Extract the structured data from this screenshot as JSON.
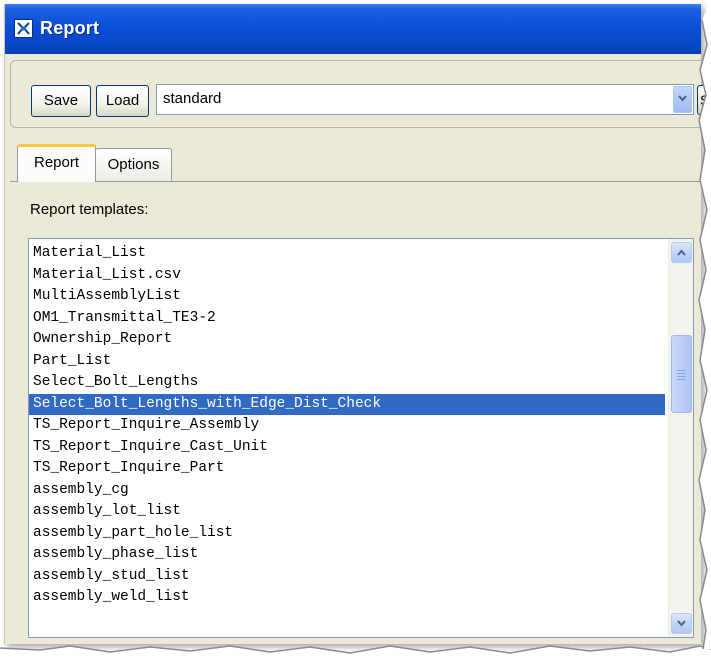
{
  "window": {
    "title": "Report",
    "icon": "app-icon"
  },
  "toolbar": {
    "save_label": "Save",
    "load_label": "Load",
    "template_combo_value": "standard",
    "edge_button_partial": "S"
  },
  "tabs": [
    {
      "label": "Report",
      "active": true
    },
    {
      "label": "Options",
      "active": false
    }
  ],
  "report_templates": {
    "label": "Report templates:",
    "items": [
      "Material_List",
      "Material_List.csv",
      "MultiAssemblyList",
      "OM1_Transmittal_TE3-2",
      "Ownership_Report",
      "Part_List",
      "Select_Bolt_Lengths",
      "Select_Bolt_Lengths_with_Edge_Dist_Check",
      "TS_Report_Inquire_Assembly",
      "TS_Report_Inquire_Cast_Unit",
      "TS_Report_Inquire_Part",
      "assembly_cg",
      "assembly_lot_list",
      "assembly_part_hole_list",
      "assembly_phase_list",
      "assembly_stud_list",
      "assembly_weld_list"
    ],
    "selected_index": 7
  },
  "colors": {
    "titlebar": "#0a4fd6",
    "selection": "#316ac5",
    "window_bg": "#ece9d8",
    "active_tab_accent": "#ffc83c"
  }
}
